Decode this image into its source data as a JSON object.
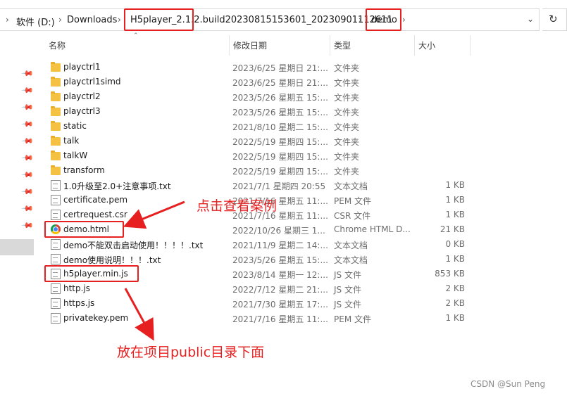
{
  "breadcrumb": {
    "items": [
      "软件 (D:)",
      "Downloads",
      "H5player_2.1.2.build20230815153601_20230901112611",
      "demo"
    ],
    "separator": "›",
    "dropdown_icon": "chevron-down-icon",
    "refresh_icon": "refresh-icon"
  },
  "columns": {
    "name": "名称",
    "date": "修改日期",
    "type": "类型",
    "size": "大小"
  },
  "files": [
    {
      "name": "playctrl1",
      "date": "2023/6/25 星期日 21:...",
      "type": "文件夹",
      "size": "",
      "icon": "folder-icon"
    },
    {
      "name": "playctrl1simd",
      "date": "2023/6/25 星期日 21:...",
      "type": "文件夹",
      "size": "",
      "icon": "folder-icon"
    },
    {
      "name": "playctrl2",
      "date": "2023/5/26 星期五 15:...",
      "type": "文件夹",
      "size": "",
      "icon": "folder-icon"
    },
    {
      "name": "playctrl3",
      "date": "2023/5/26 星期五 15:...",
      "type": "文件夹",
      "size": "",
      "icon": "folder-icon"
    },
    {
      "name": "static",
      "date": "2021/8/10 星期二 15:...",
      "type": "文件夹",
      "size": "",
      "icon": "folder-icon"
    },
    {
      "name": "talk",
      "date": "2022/5/19 星期四 15:...",
      "type": "文件夹",
      "size": "",
      "icon": "folder-icon"
    },
    {
      "name": "talkW",
      "date": "2022/5/19 星期四 15:...",
      "type": "文件夹",
      "size": "",
      "icon": "folder-icon"
    },
    {
      "name": "transform",
      "date": "2022/5/19 星期四 15:...",
      "type": "文件夹",
      "size": "",
      "icon": "folder-icon"
    },
    {
      "name": "1.0升级至2.0+注意事项.txt",
      "date": "2021/7/1 星期四 20:55",
      "type": "文本文档",
      "size": "1 KB",
      "icon": "text-file-icon"
    },
    {
      "name": "certificate.pem",
      "date": "2021/7/16 星期五 11:...",
      "type": "PEM 文件",
      "size": "1 KB",
      "icon": "file-icon"
    },
    {
      "name": "certrequest.csr",
      "date": "2021/7/16 星期五 11:...",
      "type": "CSR 文件",
      "size": "1 KB",
      "icon": "file-icon"
    },
    {
      "name": "demo.html",
      "date": "2022/10/26 星期三 1...",
      "type": "Chrome HTML D...",
      "size": "21 KB",
      "icon": "chrome-icon"
    },
    {
      "name": "demo不能双击启动使用！！！！.txt",
      "date": "2021/11/9 星期二 14:...",
      "type": "文本文档",
      "size": "0 KB",
      "icon": "text-file-icon"
    },
    {
      "name": "demo使用说明！！！.txt",
      "date": "2023/5/26 星期五 15:...",
      "type": "文本文档",
      "size": "1 KB",
      "icon": "text-file-icon"
    },
    {
      "name": "h5player.min.js",
      "date": "2023/8/14 星期一 12:...",
      "type": "JS 文件",
      "size": "853 KB",
      "icon": "js-file-icon"
    },
    {
      "name": "http.js",
      "date": "2022/7/12 星期二 21:...",
      "type": "JS 文件",
      "size": "2 KB",
      "icon": "js-file-icon"
    },
    {
      "name": "https.js",
      "date": "2021/7/30 星期五 17:...",
      "type": "JS 文件",
      "size": "2 KB",
      "icon": "js-file-icon"
    },
    {
      "name": "privatekey.pem",
      "date": "2021/7/16 星期五 11:...",
      "type": "PEM 文件",
      "size": "1 KB",
      "icon": "file-icon"
    }
  ],
  "annotations": {
    "demo_note": "点击查看案例",
    "h5player_note": "放在项目public目录下面",
    "highlight_color": "#e62020"
  },
  "watermark": "CSDN @Sun   Peng"
}
